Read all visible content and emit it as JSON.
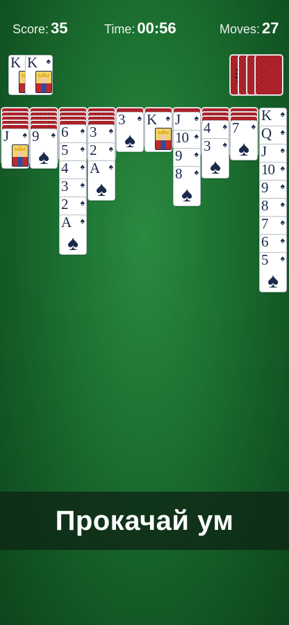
{
  "hud": {
    "score_label": "Score:",
    "score_value": "35",
    "time_label": "Time:",
    "time_value": "00:56",
    "moves_label": "Moves:",
    "moves_value": "27"
  },
  "suit_symbol": "♠",
  "spider_icon": "spider-icon",
  "foundations": [
    {
      "rank": "K",
      "face": true
    },
    {
      "rank": "K",
      "face": true
    }
  ],
  "stock_count": 4,
  "tableau": [
    {
      "hidden": 5,
      "cards": [
        "J"
      ]
    },
    {
      "hidden": 5,
      "cards": [
        "9"
      ]
    },
    {
      "hidden": 4,
      "cards": [
        "6",
        "5",
        "4",
        "3",
        "2",
        "A"
      ]
    },
    {
      "hidden": 4,
      "cards": [
        "3",
        "2",
        "A"
      ]
    },
    {
      "hidden": 1,
      "cards": [
        "3"
      ]
    },
    {
      "hidden": 1,
      "cards": [
        "K"
      ]
    },
    {
      "hidden": 1,
      "cards": [
        "J",
        "10",
        "9",
        "8"
      ]
    },
    {
      "hidden": 3,
      "cards": [
        "4",
        "3"
      ]
    },
    {
      "hidden": 3,
      "cards": [
        "7"
      ]
    },
    {
      "hidden": 0,
      "cards": [
        "K",
        "Q",
        "J",
        "10",
        "9",
        "8",
        "7",
        "6",
        "5"
      ]
    }
  ],
  "banner": {
    "text": "Прокачай ум"
  },
  "colors": {
    "felt": "#1d7332",
    "card_back": "#b8262e",
    "ink": "#1b2a4a"
  }
}
